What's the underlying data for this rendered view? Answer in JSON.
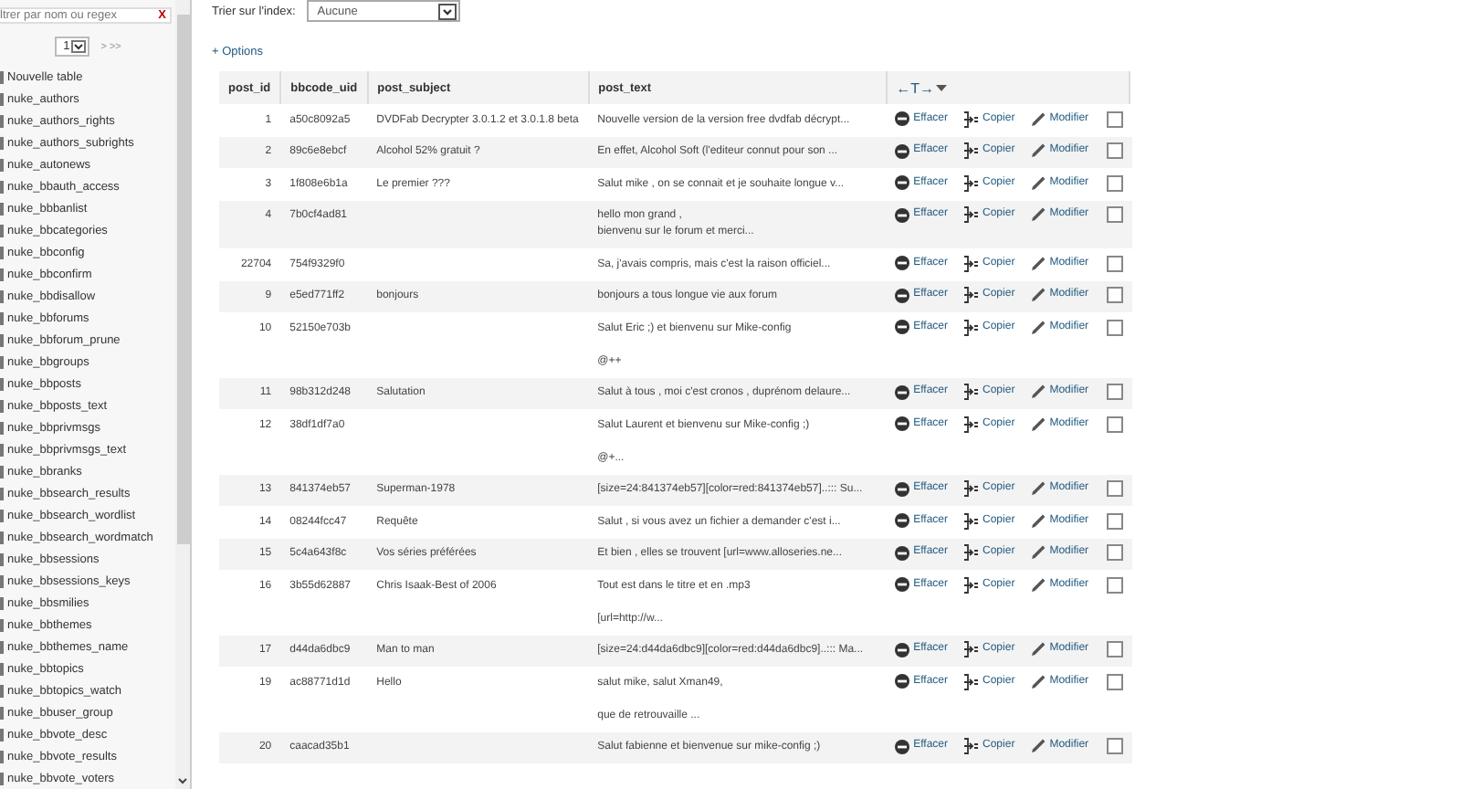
{
  "sidebar": {
    "filter": {
      "placeholder": "ltrer par nom ou regex",
      "clear": "X"
    },
    "pager": {
      "page": "1",
      "next": "> >>"
    },
    "tables": [
      "Nouvelle table",
      "nuke_authors",
      "nuke_authors_rights",
      "nuke_authors_subrights",
      "nuke_autonews",
      "nuke_bbauth_access",
      "nuke_bbbanlist",
      "nuke_bbcategories",
      "nuke_bbconfig",
      "nuke_bbconfirm",
      "nuke_bbdisallow",
      "nuke_bbforums",
      "nuke_bbforum_prune",
      "nuke_bbgroups",
      "nuke_bbposts",
      "nuke_bbposts_text",
      "nuke_bbprivmsgs",
      "nuke_bbprivmsgs_text",
      "nuke_bbranks",
      "nuke_bbsearch_results",
      "nuke_bbsearch_wordlist",
      "nuke_bbsearch_wordmatch",
      "nuke_bbsessions",
      "nuke_bbsessions_keys",
      "nuke_bbsmilies",
      "nuke_bbthemes",
      "nuke_bbthemes_name",
      "nuke_bbtopics",
      "nuke_bbtopics_watch",
      "nuke_bbuser_group",
      "nuke_bbvote_desc",
      "nuke_bbvote_results",
      "nuke_bbvote_voters"
    ]
  },
  "sort": {
    "label": "Trier sur l'index:",
    "value": "Aucune"
  },
  "options_link": "+ Options",
  "table": {
    "columns": [
      "post_id",
      "bbcode_uid",
      "post_subject",
      "post_text"
    ],
    "actions_header": "←T→",
    "rows": [
      {
        "cells": [
          "1",
          "a50c8092a5",
          "DVDFab Decrypter 3.0.1.2 et 3.0.1.8 beta",
          "Nouvelle version de la version free dvdfab décrypt..."
        ],
        "actions": [
          {
            "kind": "delete",
            "label": "Effacer"
          },
          {
            "kind": "copy",
            "label": "Copier"
          },
          {
            "kind": "edit",
            "label": "Modifier"
          }
        ],
        "checked": false
      },
      {
        "cells": [
          "2",
          "89c6e8ebcf",
          "Alcohol 52% gratuit ?",
          "En effet, Alcohol Soft (l'editeur connut pour son ..."
        ],
        "actions": [
          {
            "kind": "delete",
            "label": "Effacer"
          },
          {
            "kind": "copy",
            "label": "Copier"
          },
          {
            "kind": "edit",
            "label": "Modifier"
          }
        ],
        "checked": false
      },
      {
        "cells": [
          "3",
          "1f808e6b1a",
          "Le premier ???",
          "Salut mike , on se connait et je souhaite longue v..."
        ],
        "actions": [
          {
            "kind": "delete",
            "label": "Effacer"
          },
          {
            "kind": "copy",
            "label": "Copier"
          },
          {
            "kind": "edit",
            "label": "Modifier"
          }
        ],
        "checked": false
      },
      {
        "cells": [
          "4",
          "7b0cf4ad81",
          "",
          "hello mon grand ,\nbienvenu sur le forum et merci..."
        ],
        "actions": [
          {
            "kind": "delete",
            "label": "Effacer"
          },
          {
            "kind": "copy",
            "label": "Copier"
          },
          {
            "kind": "edit",
            "label": "Modifier"
          }
        ],
        "checked": false
      },
      {
        "cells": [
          "22704",
          "754f9329f0",
          "",
          "Sa, j'avais compris, mais c'est la raison officiel..."
        ],
        "actions": [
          {
            "kind": "delete",
            "label": "Effacer"
          },
          {
            "kind": "copy",
            "label": "Copier"
          },
          {
            "kind": "edit",
            "label": "Modifier"
          }
        ],
        "checked": false
      },
      {
        "cells": [
          "9",
          "e5ed771ff2",
          "bonjours",
          "bonjours a tous longue vie aux forum"
        ],
        "actions": [
          {
            "kind": "delete",
            "label": "Effacer"
          },
          {
            "kind": "copy",
            "label": "Copier"
          },
          {
            "kind": "edit",
            "label": "Modifier"
          }
        ],
        "checked": false
      },
      {
        "cells": [
          "10",
          "52150e703b",
          "",
          "Salut Eric ;) et bienvenu sur Mike-config\n\n@++"
        ],
        "actions": [
          {
            "kind": "delete",
            "label": "Effacer"
          },
          {
            "kind": "copy",
            "label": "Copier"
          },
          {
            "kind": "edit",
            "label": "Modifier"
          }
        ],
        "checked": false
      },
      {
        "cells": [
          "11",
          "98b312d248",
          "Salutation",
          "Salut à tous , moi c'est cronos , duprénom delaure..."
        ],
        "actions": [
          {
            "kind": "delete",
            "label": "Effacer"
          },
          {
            "kind": "copy",
            "label": "Copier"
          },
          {
            "kind": "edit",
            "label": "Modifier"
          }
        ],
        "checked": false
      },
      {
        "cells": [
          "12",
          "38df1df7a0",
          "",
          "Salut Laurent et bienvenu sur Mike-config ;)\n\n@+..."
        ],
        "actions": [
          {
            "kind": "delete",
            "label": "Effacer"
          },
          {
            "kind": "copy",
            "label": "Copier"
          },
          {
            "kind": "edit",
            "label": "Modifier"
          }
        ],
        "checked": false
      },
      {
        "cells": [
          "13",
          "841374eb57",
          "Superman-1978",
          "[size=24:841374eb57][color=red:841374eb57]..::: Su..."
        ],
        "actions": [
          {
            "kind": "delete",
            "label": "Effacer"
          },
          {
            "kind": "copy",
            "label": "Copier"
          },
          {
            "kind": "edit",
            "label": "Modifier"
          }
        ],
        "checked": false
      },
      {
        "cells": [
          "14",
          "08244fcc47",
          "Requête",
          "Salut , si vous avez un fichier a demander c'est i..."
        ],
        "actions": [
          {
            "kind": "delete",
            "label": "Effacer"
          },
          {
            "kind": "copy",
            "label": "Copier"
          },
          {
            "kind": "edit",
            "label": "Modifier"
          }
        ],
        "checked": false
      },
      {
        "cells": [
          "15",
          "5c4a643f8c",
          "Vos séries préférées",
          "Et bien , elles se trouvent [url=www.alloseries.ne..."
        ],
        "actions": [
          {
            "kind": "delete",
            "label": "Effacer"
          },
          {
            "kind": "copy",
            "label": "Copier"
          },
          {
            "kind": "edit",
            "label": "Modifier"
          }
        ],
        "checked": false
      },
      {
        "cells": [
          "16",
          "3b55d62887",
          "Chris Isaak-Best of 2006",
          "Tout est dans le titre et en .mp3\n\n[url=http://w..."
        ],
        "actions": [
          {
            "kind": "delete",
            "label": "Effacer"
          },
          {
            "kind": "copy",
            "label": "Copier"
          },
          {
            "kind": "edit",
            "label": "Modifier"
          }
        ],
        "checked": false
      },
      {
        "cells": [
          "17",
          "d44da6dbc9",
          "Man to man",
          "[size=24:d44da6dbc9][color=red:d44da6dbc9]..::: Ma..."
        ],
        "actions": [
          {
            "kind": "delete",
            "label": "Effacer"
          },
          {
            "kind": "copy",
            "label": "Copier"
          },
          {
            "kind": "edit",
            "label": "Modifier"
          }
        ],
        "checked": false
      },
      {
        "cells": [
          "19",
          "ac88771d1d",
          "Hello",
          "salut mike, salut Xman49,\n\nque de retrouvaille ..."
        ],
        "actions": [
          {
            "kind": "delete",
            "label": "Effacer"
          },
          {
            "kind": "copy",
            "label": "Copier"
          },
          {
            "kind": "edit",
            "label": "Modifier"
          }
        ],
        "checked": false
      },
      {
        "cells": [
          "20",
          "caacad35b1",
          "",
          "Salut fabienne et bienvenue sur mike-config ;)"
        ],
        "actions": [
          {
            "kind": "delete",
            "label": "Effacer"
          },
          {
            "kind": "copy",
            "label": "Copier"
          },
          {
            "kind": "edit",
            "label": "Modifier"
          }
        ],
        "checked": false
      }
    ]
  }
}
